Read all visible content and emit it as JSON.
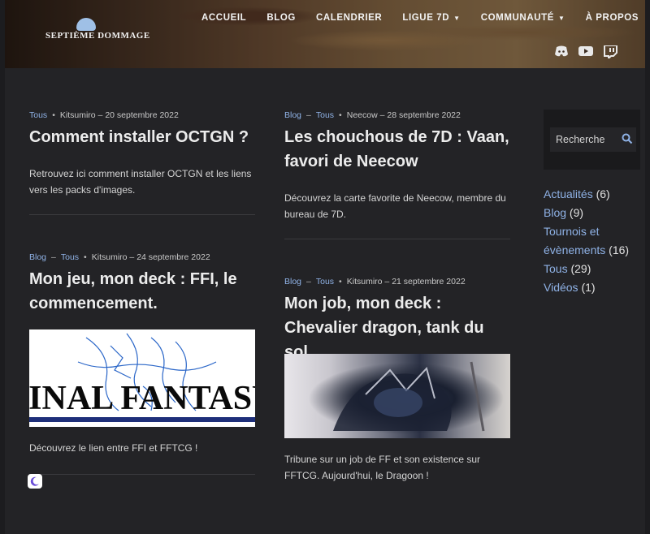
{
  "logo": {
    "text": "SEPTIÈME DOMMAGE"
  },
  "nav": {
    "items": [
      {
        "label": "ACCUEIL",
        "dropdown": false
      },
      {
        "label": "BLOG",
        "dropdown": false
      },
      {
        "label": "CALENDRIER",
        "dropdown": false
      },
      {
        "label": "LIGUE 7D",
        "dropdown": true
      },
      {
        "label": "COMMUNAUTÉ",
        "dropdown": true
      },
      {
        "label": "À PROPOS",
        "dropdown": false
      }
    ]
  },
  "social": [
    "discord-icon",
    "youtube-icon",
    "twitch-icon"
  ],
  "posts": [
    {
      "tags": [
        "Tous"
      ],
      "author": "Kitsumiro",
      "date": "20 septembre 2022",
      "title": "Comment installer OCTGN ?",
      "excerpt": "Retrouvez ici comment installer OCTGN et les liens vers les packs d'images."
    },
    {
      "tags": [
        "Blog",
        "Tous"
      ],
      "author": "Neecow",
      "date": "28 septembre 2022",
      "title": "Les chouchous de 7D : Vaan, favori de Neecow",
      "excerpt": "Découvrez la carte favorite de Neecow, membre du bureau de 7D."
    },
    {
      "tags": [
        "Blog",
        "Tous"
      ],
      "author": "Kitsumiro",
      "date": "24 septembre 2022",
      "title": "Mon jeu, mon deck : FFI, le commencement.",
      "image_text": "FINAL FANTASY",
      "excerpt": "Découvrez le lien entre FFI et FFTCG !"
    },
    {
      "tags": [
        "Blog",
        "Tous"
      ],
      "author": "Kitsumiro",
      "date": "21 septembre 2022",
      "title": "Mon job, mon deck : Chevalier dragon, tank du sol.",
      "excerpt": "Tribune sur un job de FF et son existence sur FFTCG. Aujourd'hui, le Dragoon !"
    }
  ],
  "search": {
    "placeholder": "Recherche"
  },
  "categories": [
    {
      "label": "Actualités",
      "count": "(6)"
    },
    {
      "label": "Blog",
      "count": "(9)"
    },
    {
      "label": "Tournois et évènements",
      "count": "(16)"
    },
    {
      "label": "Tous",
      "count": "(29)"
    },
    {
      "label": "Vidéos",
      "count": "(1)"
    }
  ],
  "colors": {
    "accent": "#8fb2e6",
    "background": "#232326"
  }
}
